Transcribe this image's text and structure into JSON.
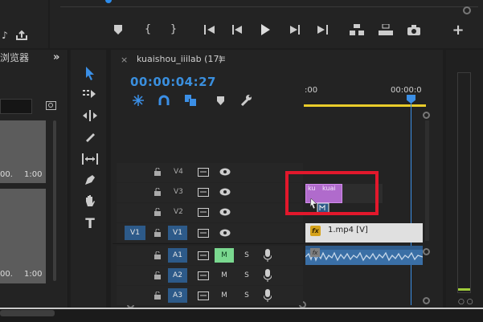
{
  "left_panel": {
    "title": "浏览器",
    "expand": "»",
    "items": [
      {
        "duration": "1:00",
        "prefix": "00."
      },
      {
        "duration": "1:00",
        "prefix": "00."
      }
    ]
  },
  "sequence": {
    "close": "×",
    "name": "kuaishou_iiilab (17)",
    "menu": "≡",
    "timecode": "00:00:04:27",
    "ruler": {
      "start": ":00",
      "end": "00:00:0"
    }
  },
  "tracks": {
    "video": [
      {
        "name": "V4",
        "target": "",
        "active": false
      },
      {
        "name": "V3",
        "target": "",
        "active": false
      },
      {
        "name": "V2",
        "target": "",
        "active": false
      },
      {
        "name": "V1",
        "target": "V1",
        "active": true
      }
    ],
    "audio": [
      {
        "name": "A1",
        "mute": "M",
        "solo": "S",
        "mute_on": true
      },
      {
        "name": "A2",
        "mute": "M",
        "solo": "S",
        "mute_on": false
      },
      {
        "name": "A3",
        "mute": "M",
        "solo": "S",
        "mute_on": false
      }
    ]
  },
  "clips": {
    "v3_label_a": "ku",
    "v3_label_b": "kuai",
    "v1_fx": "fx",
    "v1_name": "1.mp4 [V]",
    "a1_fx": "fx"
  },
  "meters": {
    "solo": "○ ○"
  },
  "colors": {
    "accent": "#2d8ceb",
    "timecode": "#3a8fde",
    "clip_video_selected": "#b06bcc",
    "clip_audio": "#3a6fa6",
    "work_area": "#e9cc2a",
    "highlight_box": "#e2182c",
    "mute_on": "#7ad88f"
  }
}
